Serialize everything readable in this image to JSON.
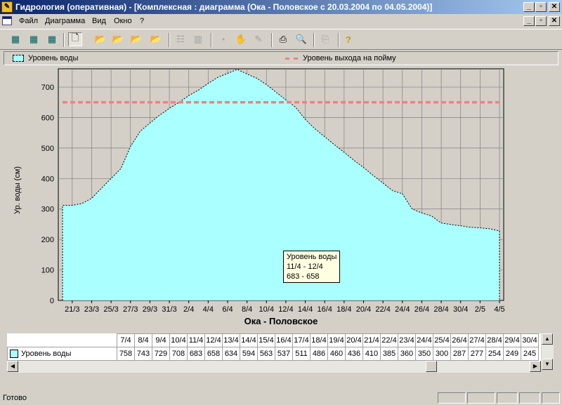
{
  "window": {
    "title": "Гидрология (оперативная) - [Комплексная : диаграмма (Ока - Половское с 20.03.2004 по 04.05.2004)]"
  },
  "menu": [
    "Файл",
    "Диаграмма",
    "Вид",
    "Окно",
    "?"
  ],
  "window_buttons": {
    "minimize": "_",
    "restore": "▫",
    "close": "✕"
  },
  "legend": {
    "area_label": "Уровень воды",
    "line_label": "Уровень выхода на пойму"
  },
  "chart_data": {
    "type": "area",
    "title": "Ока - Половское",
    "xlabel": "Ока - Половское",
    "ylabel": "Ур. воды (см)",
    "ylim": [
      0,
      760
    ],
    "yticks": [
      0,
      100,
      200,
      300,
      400,
      500,
      600,
      700
    ],
    "xtick_labels": [
      "21/3",
      "23/3",
      "25/3",
      "27/3",
      "29/3",
      "31/3",
      "2/4",
      "4/4",
      "6/4",
      "8/4",
      "10/4",
      "12/4",
      "14/4",
      "16/4",
      "18/4",
      "20/4",
      "22/4",
      "24/4",
      "26/4",
      "28/4",
      "30/4",
      "2/5",
      "4/5"
    ],
    "x": [
      "20/3",
      "21/3",
      "22/3",
      "23/3",
      "24/3",
      "25/3",
      "26/3",
      "27/3",
      "28/3",
      "29/3",
      "30/3",
      "31/3",
      "1/4",
      "2/4",
      "3/4",
      "4/4",
      "5/4",
      "6/4",
      "7/4",
      "8/4",
      "9/4",
      "10/4",
      "11/4",
      "12/4",
      "13/4",
      "14/4",
      "15/4",
      "16/4",
      "17/4",
      "18/4",
      "19/4",
      "20/4",
      "21/4",
      "22/4",
      "23/4",
      "24/4",
      "25/4",
      "26/4",
      "27/4",
      "28/4",
      "29/4",
      "30/4",
      "1/5",
      "2/5",
      "3/5",
      "4/5"
    ],
    "series": [
      {
        "name": "Уровень воды",
        "values": [
          312,
          312,
          318,
          335,
          368,
          400,
          432,
          505,
          555,
          582,
          608,
          630,
          650,
          672,
          690,
          712,
          732,
          745,
          758,
          743,
          729,
          708,
          683,
          658,
          634,
          594,
          563,
          537,
          511,
          486,
          460,
          436,
          410,
          385,
          360,
          350,
          300,
          287,
          277,
          254,
          249,
          245,
          240,
          238,
          235,
          228
        ]
      },
      {
        "name": "Уровень выхода на пойму",
        "values": [
          650,
          650,
          650,
          650,
          650,
          650,
          650,
          650,
          650,
          650,
          650,
          650,
          650,
          650,
          650,
          650,
          650,
          650,
          650,
          650,
          650,
          650,
          650,
          650,
          650,
          650,
          650,
          650,
          650,
          650,
          650,
          650,
          650,
          650,
          650,
          650,
          650,
          650,
          650,
          650,
          650,
          650,
          650,
          650,
          650,
          650
        ]
      }
    ],
    "grid": true,
    "legend_position": "top"
  },
  "tooltip": {
    "line1": "Уровень воды",
    "line2": "11/4 - 12/4",
    "line3": "683 - 658"
  },
  "table": {
    "row_label": "Уровень воды",
    "columns": [
      "7/4",
      "8/4",
      "9/4",
      "10/4",
      "11/4",
      "12/4",
      "13/4",
      "14/4",
      "15/4",
      "16/4",
      "17/4",
      "18/4",
      "19/4",
      "20/4",
      "21/4",
      "22/4",
      "23/4",
      "24/4",
      "25/4",
      "26/4",
      "27/4",
      "28/4",
      "29/4",
      "30/4"
    ],
    "values": [
      "758",
      "743",
      "729",
      "708",
      "683",
      "658",
      "634",
      "594",
      "563",
      "537",
      "511",
      "486",
      "460",
      "436",
      "410",
      "385",
      "360",
      "350",
      "300",
      "287",
      "277",
      "254",
      "249",
      "245"
    ]
  },
  "status": {
    "text": "Готово"
  },
  "colors": {
    "area": "#aaffff",
    "flood_line": "#f28080",
    "plot_bg": "#d4d0c8"
  }
}
